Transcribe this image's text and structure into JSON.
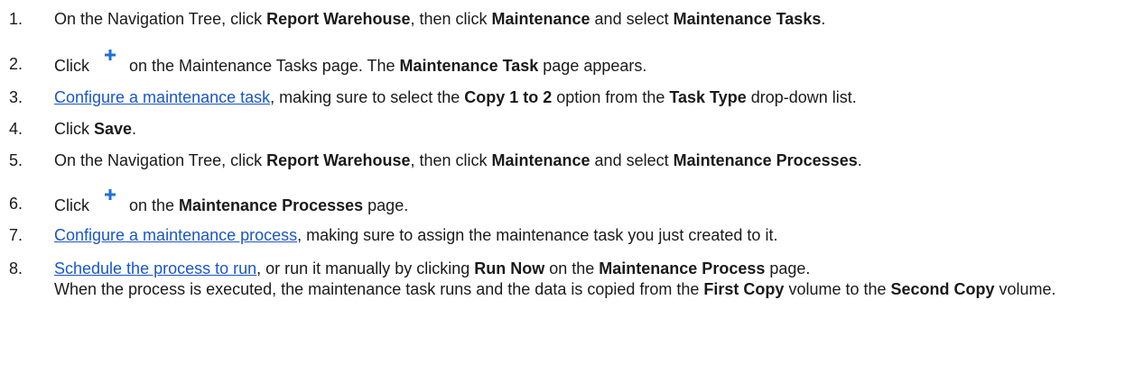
{
  "steps": [
    {
      "num": "1.",
      "parts": [
        {
          "t": "On the Navigation Tree, click "
        },
        {
          "t": "Report Warehouse",
          "b": true
        },
        {
          "t": ", then click "
        },
        {
          "t": "Maintenance",
          "b": true
        },
        {
          "t": " and select "
        },
        {
          "t": "Maintenance Tasks",
          "b": true
        },
        {
          "t": "."
        }
      ]
    },
    {
      "num": "2.",
      "parts": [
        {
          "t": "Click "
        },
        {
          "icon": "add-plus-icon"
        },
        {
          "t": " on the Maintenance Tasks page. The "
        },
        {
          "t": "Maintenance Task",
          "b": true
        },
        {
          "t": " page appears."
        }
      ]
    },
    {
      "num": "3.",
      "parts": [
        {
          "t": "Configure a maintenance task",
          "link": true
        },
        {
          "t": ", making sure to select the "
        },
        {
          "t": "Copy 1 to 2",
          "b": true
        },
        {
          "t": " option from the "
        },
        {
          "t": "Task Type",
          "b": true
        },
        {
          "t": " drop-down list."
        }
      ]
    },
    {
      "num": "4.",
      "parts": [
        {
          "t": "Click "
        },
        {
          "t": "Save",
          "b": true
        },
        {
          "t": "."
        }
      ]
    },
    {
      "num": "5.",
      "parts": [
        {
          "t": "On the Navigation Tree, click "
        },
        {
          "t": "Report Warehouse",
          "b": true
        },
        {
          "t": ", then click "
        },
        {
          "t": "Maintenance",
          "b": true
        },
        {
          "t": " and select "
        },
        {
          "t": "Maintenance Processes",
          "b": true
        },
        {
          "t": "."
        }
      ]
    },
    {
      "num": "6.",
      "parts": [
        {
          "t": "Click "
        },
        {
          "icon": "add-plus-icon"
        },
        {
          "t": " on the "
        },
        {
          "t": "Maintenance Processes",
          "b": true
        },
        {
          "t": " page."
        }
      ]
    },
    {
      "num": "7.",
      "parts": [
        {
          "t": "Configure a maintenance process",
          "link": true
        },
        {
          "t": ", making sure to assign the maintenance task you just created to it."
        }
      ]
    },
    {
      "num": "8.",
      "parts": [
        {
          "t": "Schedule the process to run",
          "link": true
        },
        {
          "t": ", or run it manually by clicking "
        },
        {
          "t": "Run Now",
          "b": true
        },
        {
          "t": " on the "
        },
        {
          "t": "Maintenance Process",
          "b": true
        },
        {
          "t": " page. "
        },
        {
          "br": true
        },
        {
          "t": "When the process is executed, the maintenance task runs and the data is copied from the "
        },
        {
          "t": "First Copy",
          "b": true
        },
        {
          "t": " volume to the "
        },
        {
          "t": "Second Copy",
          "b": true
        },
        {
          "t": " volume."
        }
      ]
    }
  ],
  "colors": {
    "link": "#1a56c8",
    "plus_icon": "#1f6fd6",
    "text": "#1a1a1a"
  }
}
